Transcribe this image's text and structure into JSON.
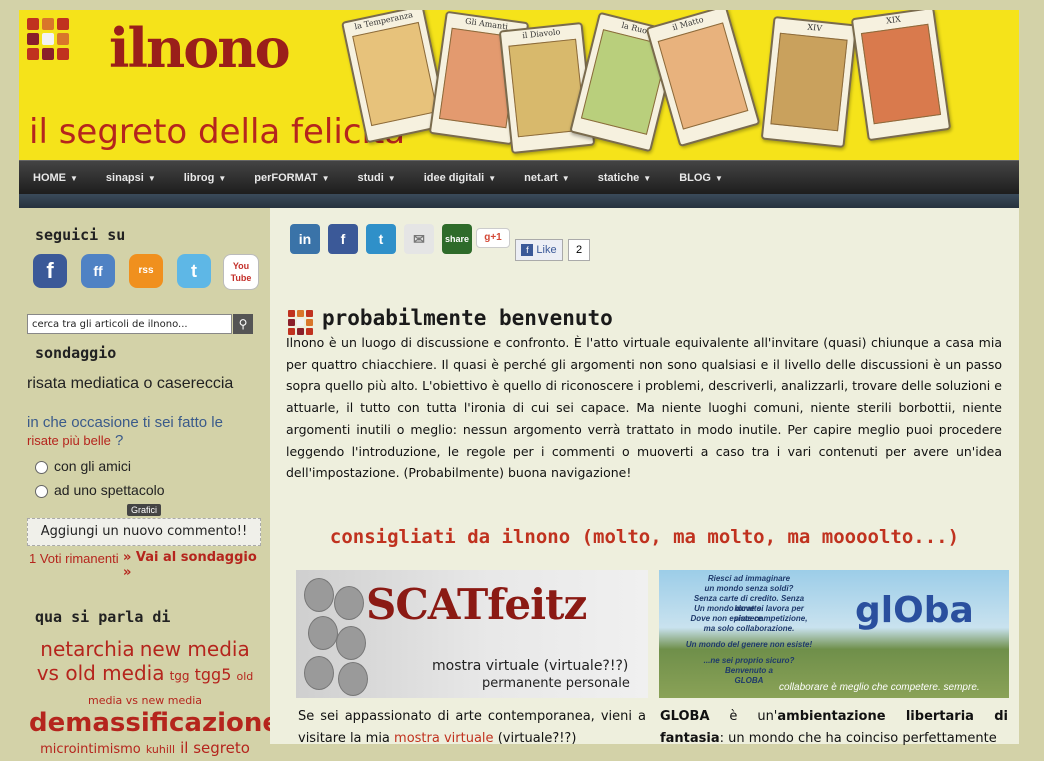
{
  "site": {
    "name": "ilnono",
    "tagline": "il segreto della felicità"
  },
  "header_cards": [
    "la Temperanza",
    "Gli Amanti",
    "il Diavolo",
    "la Ruota",
    "il Matto",
    "XIV",
    "XIX"
  ],
  "nav": {
    "items": [
      "HOME",
      "sinapsi",
      "librog",
      "perFORMAT",
      "studi",
      "idee digitali",
      "net.art",
      "statiche",
      "BLOG"
    ]
  },
  "sidebar": {
    "follow_heading": "seguici su",
    "social": [
      "f",
      "ff",
      "rss",
      "t",
      "You Tube"
    ],
    "search_placeholder": "cerca tra gli articoli de ilnono...",
    "polls_heading": "sondaggio",
    "poll_title": "risata mediatica o casereccia",
    "poll_question_a": "in che occasione ti sei fatto le",
    "poll_question_link": "risate più belle",
    "poll_question_b": "?",
    "options": [
      "con gli amici",
      "ad uno spettacolo"
    ],
    "graphs_label": "Grafici",
    "comment_button": "Aggiungi un nuovo commento!!",
    "votes": "1 Voti rimanenti",
    "goto_poll": "» Vai al sondaggio »",
    "tags_heading": "qua si parla di",
    "tags": [
      {
        "label": "netarchia",
        "size": 20
      },
      {
        "label": "new media vs old media",
        "size": 20
      },
      {
        "label": "tgg",
        "size": 12
      },
      {
        "label": "tgg5",
        "size": 16
      },
      {
        "label": "old media vs new media",
        "size": 11
      },
      {
        "label": "demassificazione",
        "size": 26
      },
      {
        "label": "microintimismo",
        "size": 13
      },
      {
        "label": "kuhill",
        "size": 11
      },
      {
        "label": "il segreto",
        "size": 15
      }
    ]
  },
  "share": {
    "icons": [
      "in",
      "f",
      "t",
      "✉",
      "share",
      "g+1"
    ],
    "like_label": "Like",
    "like_count": "2"
  },
  "main": {
    "title": "probabilmente benvenuto",
    "intro": "Ilnono è un luogo di discussione e confronto. È l'atto virtuale equivalente all'invitare (quasi) chiunque a casa mia per quattro chiacchiere. Il quasi è perché gli argomenti non sono qualsiasi e il livello delle discussioni è un passo sopra quello più alto. L'obiettivo è quello di riconoscere i problemi, descriverli, analizzarli, trovare delle soluzioni e attuarle, il tutto con tutta l'ironia di cui sei capace. Ma niente luoghi comuni, niente sterili borbottii, niente argomenti inutili o meglio: nessun argomento verrà trattato in modo inutile. Per capire meglio puoi procedere leggendo l'introduzione, le regole per i commenti o muoverti a caso tra i vari contenuti per avere un'idea dell'impostazione. (Probabilmente) buona navigazione!",
    "recommended": "consigliati da ilnono (molto, ma molto, ma moooolto...)",
    "banner1": {
      "title": "SCATfeitz",
      "sub1": "mostra virtuale (virtuale?!?)",
      "sub2": "permanente personale"
    },
    "banner2": {
      "lines": [
        "Riesci ad immaginare",
        "un mondo senza soldi?",
        "Senza carte di credito. Senza baratto.",
        "Un mondo dove si lavora per piacere.",
        "Dove non esiste competizione,",
        "ma solo collaborazione.",
        "Un mondo del genere non esiste!",
        "...ne sei proprio sicuro?",
        "Benvenuto a",
        "GLOBA"
      ],
      "logo": "glOba",
      "footer": "collaborare è meglio che competere. sempre."
    },
    "col1_a": "Se sei appassionato di arte contemporanea, vieni a visitare la mia",
    "col1_link": "mostra virtuale",
    "col1_b": "(virtuale?!?)",
    "col2_a": "GLOBA",
    "col2_b": "è un'",
    "col2_c": "ambientazione libertaria di fantasia",
    "col2_d": ": un mondo che ha coinciso perfettamente"
  }
}
